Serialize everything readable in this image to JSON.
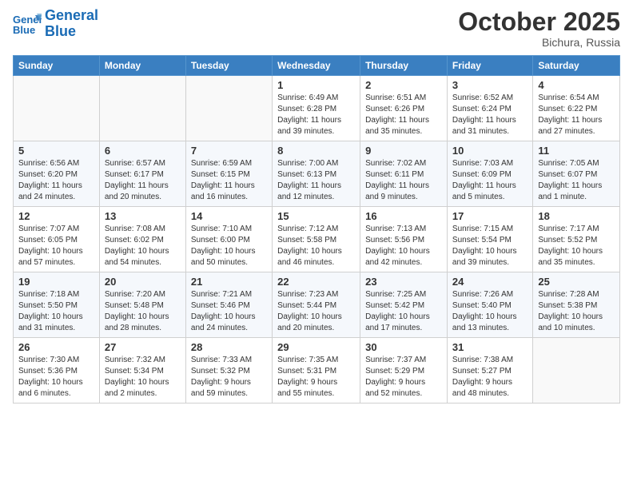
{
  "header": {
    "logo_line1": "General",
    "logo_line2": "Blue",
    "month": "October 2025",
    "location": "Bichura, Russia"
  },
  "days_of_week": [
    "Sunday",
    "Monday",
    "Tuesday",
    "Wednesday",
    "Thursday",
    "Friday",
    "Saturday"
  ],
  "weeks": [
    [
      {
        "num": "",
        "info": ""
      },
      {
        "num": "",
        "info": ""
      },
      {
        "num": "",
        "info": ""
      },
      {
        "num": "1",
        "info": "Sunrise: 6:49 AM\nSunset: 6:28 PM\nDaylight: 11 hours\nand 39 minutes."
      },
      {
        "num": "2",
        "info": "Sunrise: 6:51 AM\nSunset: 6:26 PM\nDaylight: 11 hours\nand 35 minutes."
      },
      {
        "num": "3",
        "info": "Sunrise: 6:52 AM\nSunset: 6:24 PM\nDaylight: 11 hours\nand 31 minutes."
      },
      {
        "num": "4",
        "info": "Sunrise: 6:54 AM\nSunset: 6:22 PM\nDaylight: 11 hours\nand 27 minutes."
      }
    ],
    [
      {
        "num": "5",
        "info": "Sunrise: 6:56 AM\nSunset: 6:20 PM\nDaylight: 11 hours\nand 24 minutes."
      },
      {
        "num": "6",
        "info": "Sunrise: 6:57 AM\nSunset: 6:17 PM\nDaylight: 11 hours\nand 20 minutes."
      },
      {
        "num": "7",
        "info": "Sunrise: 6:59 AM\nSunset: 6:15 PM\nDaylight: 11 hours\nand 16 minutes."
      },
      {
        "num": "8",
        "info": "Sunrise: 7:00 AM\nSunset: 6:13 PM\nDaylight: 11 hours\nand 12 minutes."
      },
      {
        "num": "9",
        "info": "Sunrise: 7:02 AM\nSunset: 6:11 PM\nDaylight: 11 hours\nand 9 minutes."
      },
      {
        "num": "10",
        "info": "Sunrise: 7:03 AM\nSunset: 6:09 PM\nDaylight: 11 hours\nand 5 minutes."
      },
      {
        "num": "11",
        "info": "Sunrise: 7:05 AM\nSunset: 6:07 PM\nDaylight: 11 hours\nand 1 minute."
      }
    ],
    [
      {
        "num": "12",
        "info": "Sunrise: 7:07 AM\nSunset: 6:05 PM\nDaylight: 10 hours\nand 57 minutes."
      },
      {
        "num": "13",
        "info": "Sunrise: 7:08 AM\nSunset: 6:02 PM\nDaylight: 10 hours\nand 54 minutes."
      },
      {
        "num": "14",
        "info": "Sunrise: 7:10 AM\nSunset: 6:00 PM\nDaylight: 10 hours\nand 50 minutes."
      },
      {
        "num": "15",
        "info": "Sunrise: 7:12 AM\nSunset: 5:58 PM\nDaylight: 10 hours\nand 46 minutes."
      },
      {
        "num": "16",
        "info": "Sunrise: 7:13 AM\nSunset: 5:56 PM\nDaylight: 10 hours\nand 42 minutes."
      },
      {
        "num": "17",
        "info": "Sunrise: 7:15 AM\nSunset: 5:54 PM\nDaylight: 10 hours\nand 39 minutes."
      },
      {
        "num": "18",
        "info": "Sunrise: 7:17 AM\nSunset: 5:52 PM\nDaylight: 10 hours\nand 35 minutes."
      }
    ],
    [
      {
        "num": "19",
        "info": "Sunrise: 7:18 AM\nSunset: 5:50 PM\nDaylight: 10 hours\nand 31 minutes."
      },
      {
        "num": "20",
        "info": "Sunrise: 7:20 AM\nSunset: 5:48 PM\nDaylight: 10 hours\nand 28 minutes."
      },
      {
        "num": "21",
        "info": "Sunrise: 7:21 AM\nSunset: 5:46 PM\nDaylight: 10 hours\nand 24 minutes."
      },
      {
        "num": "22",
        "info": "Sunrise: 7:23 AM\nSunset: 5:44 PM\nDaylight: 10 hours\nand 20 minutes."
      },
      {
        "num": "23",
        "info": "Sunrise: 7:25 AM\nSunset: 5:42 PM\nDaylight: 10 hours\nand 17 minutes."
      },
      {
        "num": "24",
        "info": "Sunrise: 7:26 AM\nSunset: 5:40 PM\nDaylight: 10 hours\nand 13 minutes."
      },
      {
        "num": "25",
        "info": "Sunrise: 7:28 AM\nSunset: 5:38 PM\nDaylight: 10 hours\nand 10 minutes."
      }
    ],
    [
      {
        "num": "26",
        "info": "Sunrise: 7:30 AM\nSunset: 5:36 PM\nDaylight: 10 hours\nand 6 minutes."
      },
      {
        "num": "27",
        "info": "Sunrise: 7:32 AM\nSunset: 5:34 PM\nDaylight: 10 hours\nand 2 minutes."
      },
      {
        "num": "28",
        "info": "Sunrise: 7:33 AM\nSunset: 5:32 PM\nDaylight: 9 hours\nand 59 minutes."
      },
      {
        "num": "29",
        "info": "Sunrise: 7:35 AM\nSunset: 5:31 PM\nDaylight: 9 hours\nand 55 minutes."
      },
      {
        "num": "30",
        "info": "Sunrise: 7:37 AM\nSunset: 5:29 PM\nDaylight: 9 hours\nand 52 minutes."
      },
      {
        "num": "31",
        "info": "Sunrise: 7:38 AM\nSunset: 5:27 PM\nDaylight: 9 hours\nand 48 minutes."
      },
      {
        "num": "",
        "info": ""
      }
    ]
  ]
}
